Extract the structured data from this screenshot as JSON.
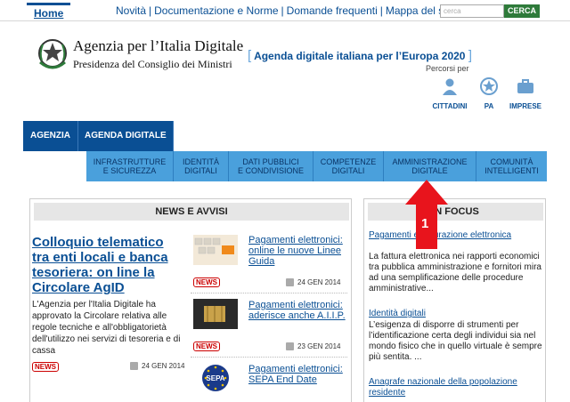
{
  "topnav": {
    "home": "Home",
    "links": [
      "Novità",
      "Documentazione e Norme",
      "Domande frequenti",
      "Mappa del sito"
    ],
    "search_placeholder": "cerca",
    "search_button": "CERCA"
  },
  "header": {
    "title": "Agenzia per l’Italia Digitale",
    "subtitle": "Presidenza del Consiglio dei Ministri",
    "agenda_link": "Agenda digitale italiana per l’Europa 2020",
    "percorsi_label": "Percorsi per",
    "personas": [
      "CITTADINI",
      "PA",
      "IMPRESE"
    ]
  },
  "mainnav": [
    "AGENZIA",
    "AGENDA DIGITALE"
  ],
  "subnav": [
    [
      "INFRASTRUTTURE",
      "E SICUREZZA"
    ],
    [
      "IDENTITÀ",
      "DIGITALI"
    ],
    [
      "DATI PUBBLICI",
      "E CONDIVISIONE"
    ],
    [
      "COMPETENZE",
      "DIGITALI"
    ],
    [
      "AMMINISTRAZIONE",
      "DIGITALE"
    ],
    [
      "COMUNITÀ",
      "INTELLIGENTI"
    ]
  ],
  "news": {
    "header": "NEWS E AVVISI",
    "lead": {
      "title": "Colloquio telematico tra enti locali e banca tesoriera: on line la Circolare AgID",
      "text": "L'Agenzia per l'Italia Digitale ha approvato la Circolare relativa alle regole tecniche e all'obbligatorietà dell'utilizzo nei servizi di tesoreria e di cassa",
      "badge": "NEWS",
      "date": "24 GEN 2014"
    },
    "items": [
      {
        "title": "Pagamenti elettronici: online le nuove Linee Guida",
        "badge": "NEWS",
        "date": "24 GEN 2014"
      },
      {
        "title": "Pagamenti elettronici: aderisce anche A.I.I.P.",
        "badge": "NEWS",
        "date": "23 GEN 2014"
      },
      {
        "title": "Pagamenti elettronici: SEPA End Date",
        "badge": "",
        "date": ""
      }
    ]
  },
  "focus": {
    "header": "IN FOCUS",
    "items": [
      {
        "title": "Pagamenti e fatturazione elettronica",
        "text": "La fattura elettronica nei rapporti economici tra pubblica amministrazione e fornitori mira ad una semplificazione delle procedure amministrative..."
      },
      {
        "title": "Identità digitali",
        "text": "L’esigenza di disporre di strumenti per l’identificazione certa degli individui sia nel mondo fisico che in quello virtuale è sempre più sentita. ..."
      },
      {
        "title": "Anagrafe nazionale della popolazione residente",
        "text": ""
      }
    ]
  },
  "annotation": {
    "label": "1",
    "color": "#e8141c"
  },
  "colors": {
    "primary": "#0a4f94",
    "subnav": "#4aa0dc",
    "badge": "#cc0000",
    "search": "#2e7a3a"
  }
}
